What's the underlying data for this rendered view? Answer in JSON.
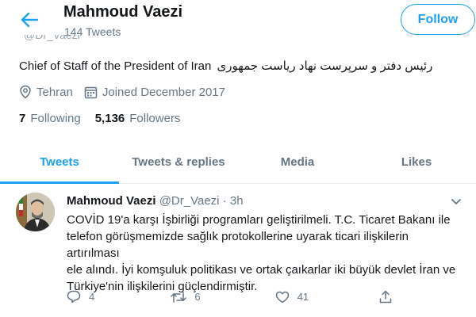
{
  "header": {
    "name": "Mahmoud Vaezi",
    "tweet_count": "144 Tweets",
    "follow_label": "Follow"
  },
  "profile": {
    "handle_peek": "@Dr_Vaezi",
    "bio_en": "Chief of Staff of the President of Iran",
    "bio_fa": "رئیس دفتر و سرپرست نهاد ریاست جمهوری",
    "location": "Tehran",
    "joined": "Joined December 2017",
    "following_count": "7",
    "following_label": "Following",
    "followers_count": "5,136",
    "followers_label": "Followers"
  },
  "tabs": [
    {
      "label": "Tweets",
      "active": true
    },
    {
      "label": "Tweets & replies",
      "active": false
    },
    {
      "label": "Media",
      "active": false
    },
    {
      "label": "Likes",
      "active": false
    }
  ],
  "tweet": {
    "author": "Mahmoud Vaezi",
    "handle": "@Dr_Vaezi",
    "dot": "·",
    "time": "3h",
    "lines": [
      "COVİD 19'a karşı İşbirliği programları geliştirilmeli. T.C. Ticaret Bakanı ile",
      "telefon görüşmemizde sağlık protokollerine uyarak ticari ilişkilerin artırılması",
      "ele alındı. İyi komşuluk politikası ve ortak çaıkarlar iki büyük devlet İran ve",
      "Türkiye'nin ilişkilerini güçlendirmiştir."
    ],
    "replies": "4",
    "retweets": "6",
    "likes": "41"
  },
  "colors": {
    "accent": "#1da1f2",
    "muted": "#657786",
    "text": "#14171a",
    "divider": "#e6ecf0"
  },
  "icons": {
    "back": "arrow-left-icon",
    "location": "location-pin-icon",
    "calendar": "calendar-icon",
    "caret": "chevron-down-icon",
    "reply": "reply-bubble-icon",
    "retweet": "retweet-icon",
    "like": "heart-icon",
    "share": "share-icon"
  }
}
